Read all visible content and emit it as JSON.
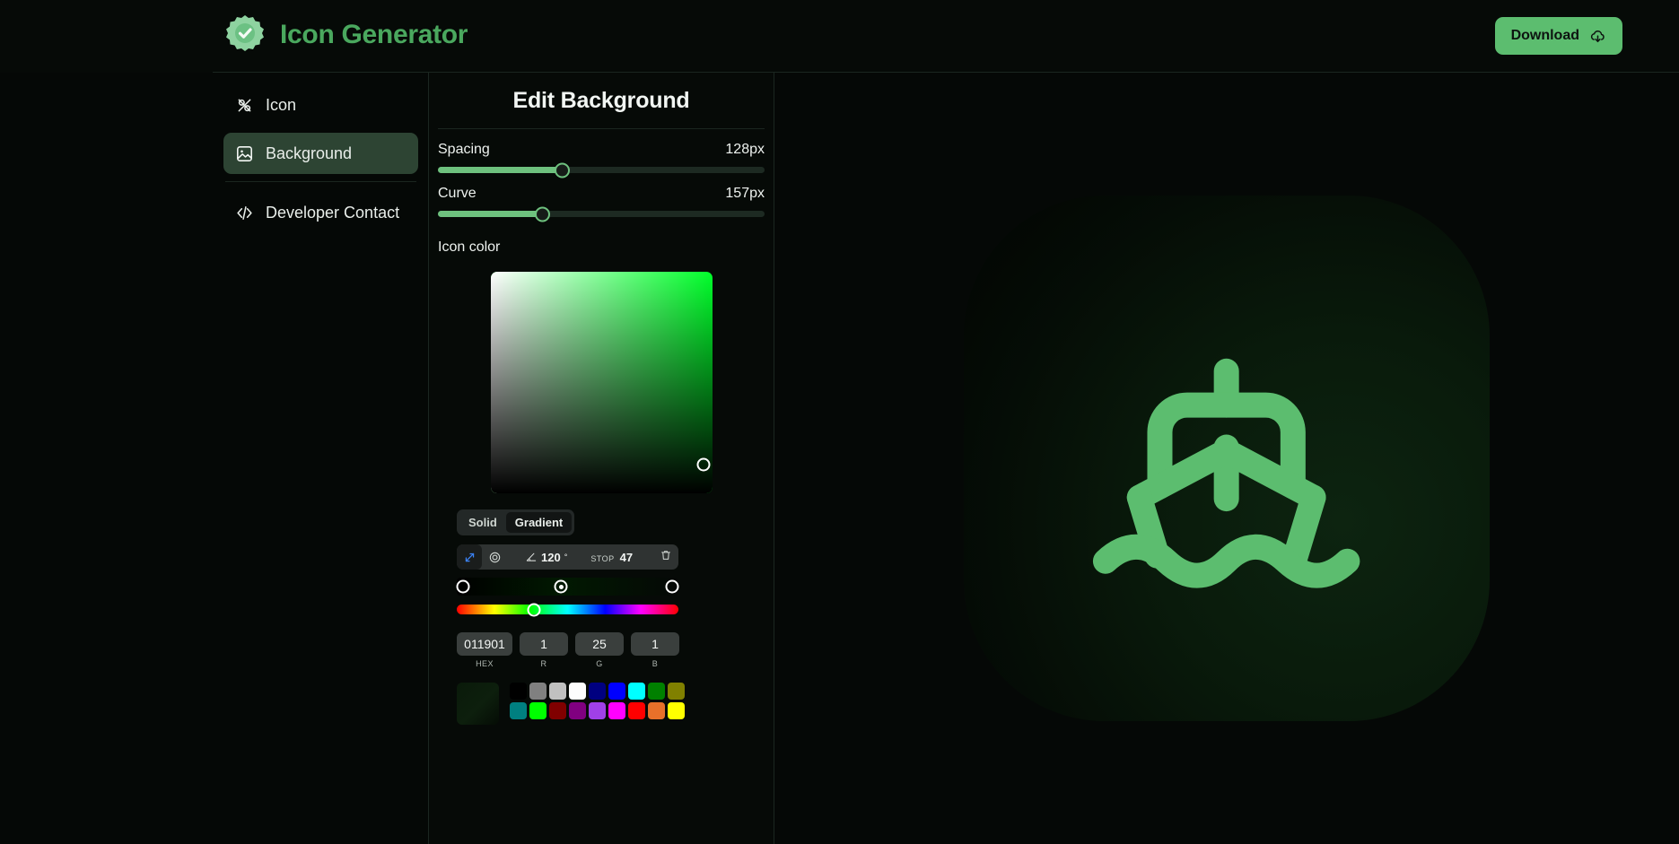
{
  "app": {
    "title": "Icon Generator",
    "brand_color": "#4aa85e",
    "badge_icon": "verified-check-badge-icon"
  },
  "header": {
    "download_label": "Download",
    "download_icon": "cloud-download-icon",
    "download_bg": "#5cbd6f"
  },
  "sidebar": {
    "items": [
      {
        "label": "Icon",
        "icon": "icon-tool-icon",
        "active": false
      },
      {
        "label": "Background",
        "icon": "image-icon",
        "active": true
      },
      {
        "label": "Developer Contact",
        "icon": "code-brackets-icon",
        "active": false
      }
    ],
    "active_bg": "#2d4433"
  },
  "editor": {
    "title": "Edit Background",
    "sliders": [
      {
        "label": "Spacing",
        "value": "128px",
        "percent": 38
      },
      {
        "label": "Curve",
        "value": "157px",
        "percent": 32
      }
    ],
    "color_section_label": "Icon color",
    "sv_picker": {
      "hue_color": "#00ff2a",
      "cursor_x_percent": 96,
      "cursor_y_percent": 87
    },
    "mode_tabs": [
      {
        "label": "Solid",
        "active": false
      },
      {
        "label": "Gradient",
        "active": true
      }
    ],
    "gradient_toolbar": {
      "linear_icon": "linear-gradient-arrow-icon",
      "radial_icon": "radial-gradient-icon",
      "angle_icon": "angle-icon",
      "angle_value": "120",
      "angle_unit": "°",
      "stop_label": "STOP",
      "stop_value": "47",
      "delete_icon": "trash-icon",
      "linear_active": true
    },
    "gradient_track": {
      "css": "linear-gradient(to right, #000000 0%, #011901 47%, #050806 100%)",
      "stops": [
        {
          "position_percent": 3,
          "selected": false
        },
        {
          "position_percent": 47,
          "selected": true
        },
        {
          "position_percent": 97,
          "selected": false
        }
      ]
    },
    "hue_slider": {
      "position_percent": 35
    },
    "fields": [
      {
        "value": "011901",
        "label": "HEX",
        "type": "hex"
      },
      {
        "value": "1",
        "label": "R",
        "type": "rgb"
      },
      {
        "value": "25",
        "label": "G",
        "type": "rgb"
      },
      {
        "value": "1",
        "label": "B",
        "type": "rgb"
      }
    ],
    "current_color": "#0d1f0d",
    "swatches": [
      "#000000",
      "#808080",
      "#c0c0c0",
      "#fdfdfd",
      "#000080",
      "#0000ff",
      "#00ffff",
      "#008000",
      "#808000",
      "#008080",
      "#00ff00",
      "#800000",
      "#800080",
      "#a040e8",
      "#ff00ff",
      "#ff0000",
      "#e8702a",
      "#ffff00"
    ]
  },
  "preview": {
    "icon_name": "ship-boat-icon",
    "icon_color": "#5cbd6f",
    "background_css": "radial-gradient(circle at 72% 62%, #0d2410 0%, #091a0b 38%, #050d06 70%, #020402 100%)",
    "corner_radius_px": 157
  }
}
